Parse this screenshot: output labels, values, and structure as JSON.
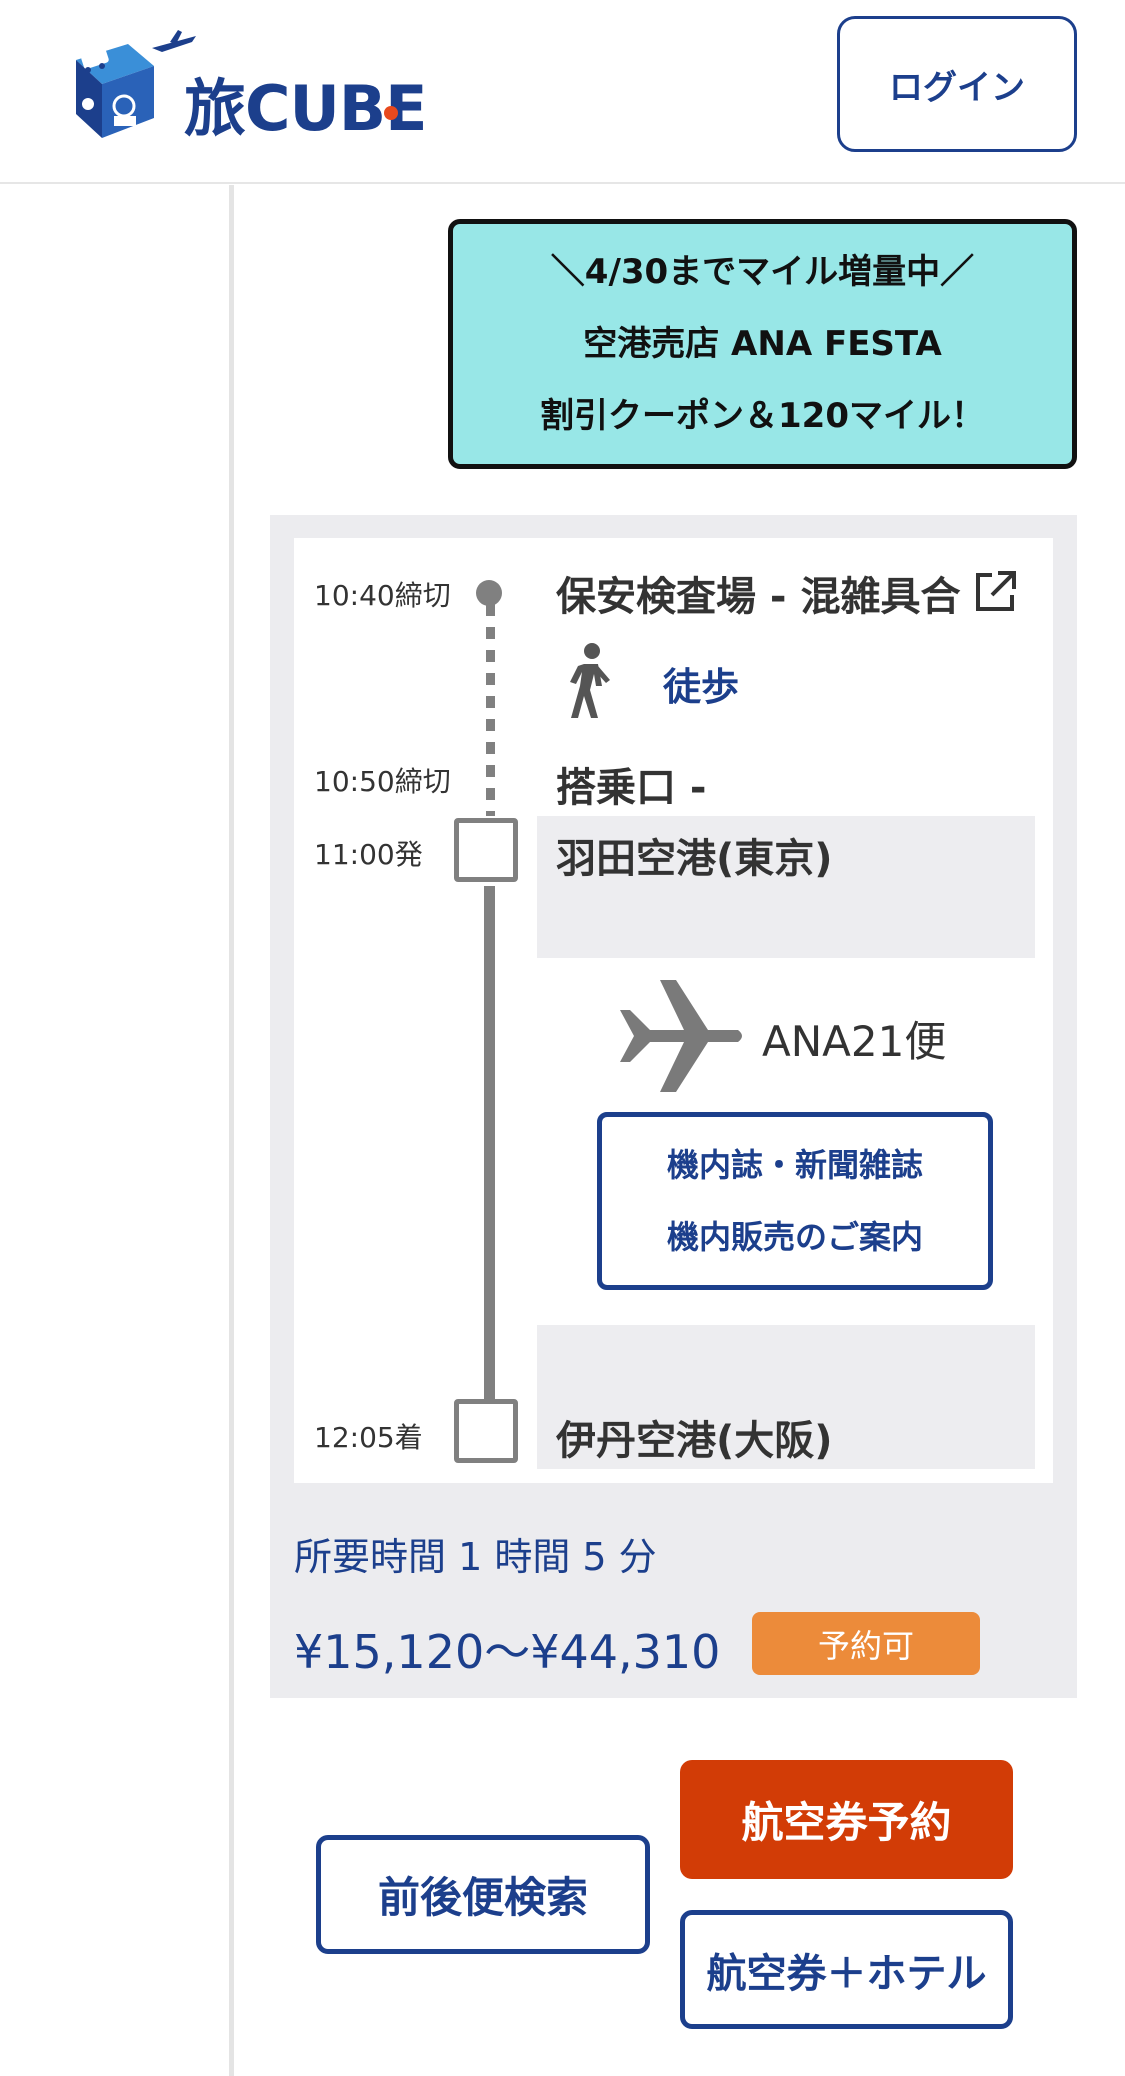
{
  "header": {
    "logo_text": "旅CUBE",
    "login_label": "ログイン"
  },
  "promo": {
    "line1": "＼4/30までマイル増量中／",
    "line2": "空港売店 ANA FESTA",
    "line3": "割引クーポン＆120マイル！"
  },
  "timeline": {
    "security": {
      "time": "10:40締切",
      "place": "保安検査場 - 混雑具合"
    },
    "walk": {
      "label": "徒歩"
    },
    "gate": {
      "time": "10:50締切",
      "place": "搭乗口 -"
    },
    "departure": {
      "time": "11:00発",
      "place": "羽田空港(東京)"
    },
    "flight": {
      "label": "ANA21便"
    },
    "inflight_button": {
      "line1": "機内誌・新聞雑誌",
      "line2": "機内販売のご案内"
    },
    "arrival": {
      "time": "12:05着",
      "place": "伊丹空港(大阪)"
    }
  },
  "summary": {
    "duration": "所要時間 1 時間 5 分",
    "price": "¥15,120〜¥44,310",
    "status": "予約可"
  },
  "actions": {
    "book_flight": "航空券予約",
    "nearby_flights": "前後便検索",
    "flight_hotel": "航空券＋ホテル"
  },
  "colors": {
    "brand": "#1c3f8c",
    "promo_bg": "#98e7e7",
    "book_button": "#d23c06",
    "status_badge": "#ec8b3a",
    "timeline_gray": "#808080"
  },
  "icons": [
    "luggage-cube-logo-icon",
    "external-link-icon",
    "walking-person-icon",
    "airplane-icon"
  ]
}
